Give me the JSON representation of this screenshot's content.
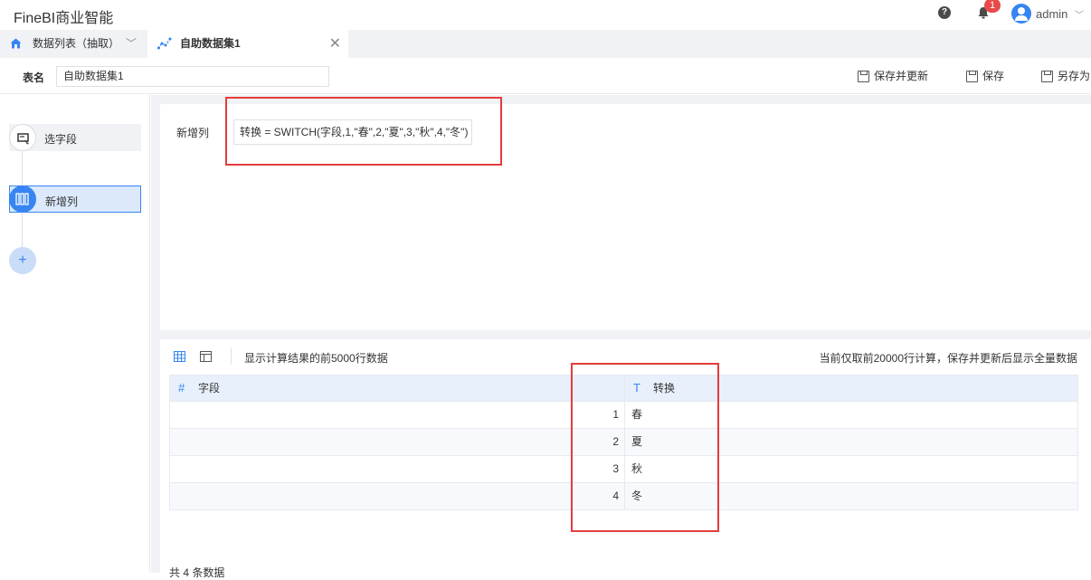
{
  "app": {
    "title": "FineBI商业智能"
  },
  "header": {
    "notification_count": "1",
    "user": "admin"
  },
  "tabs": [
    {
      "label": "数据列表（抽取）"
    },
    {
      "label": "自助数据集1"
    }
  ],
  "namebar": {
    "label": "表名",
    "value": "自助数据集1",
    "save_update": "保存并更新",
    "save": "保存",
    "save_as": "另存为"
  },
  "steps": [
    {
      "label": "选字段"
    },
    {
      "label": "新增列"
    }
  ],
  "formula": {
    "label": "新增列",
    "expression": "转换 = SWITCH(字段,1,\"春\",2,\"夏\",3,\"秋\",4,\"冬\")"
  },
  "preview": {
    "text": "显示计算结果的前5000行数据",
    "hint": "当前仅取前20000行计算，保存并更新后显示全量数据",
    "columns": [
      {
        "type": "#",
        "name": "字段"
      },
      {
        "type": "T",
        "name": "转换"
      }
    ],
    "rows": [
      {
        "c1": "1",
        "c2": "春"
      },
      {
        "c1": "2",
        "c2": "夏"
      },
      {
        "c1": "3",
        "c2": "秋"
      },
      {
        "c1": "4",
        "c2": "冬"
      }
    ],
    "count_text": "共 4 条数据"
  },
  "colors": {
    "accent": "#3685f2",
    "highlight_box": "#e43c3c",
    "badge": "#e84a4a"
  },
  "icons": [
    "help-icon",
    "bell-icon",
    "avatar-icon",
    "home-icon",
    "dataset-icon",
    "close-icon",
    "save-icon",
    "grid-icon",
    "layout-icon",
    "field-select-icon",
    "columns-icon",
    "plus-icon"
  ]
}
